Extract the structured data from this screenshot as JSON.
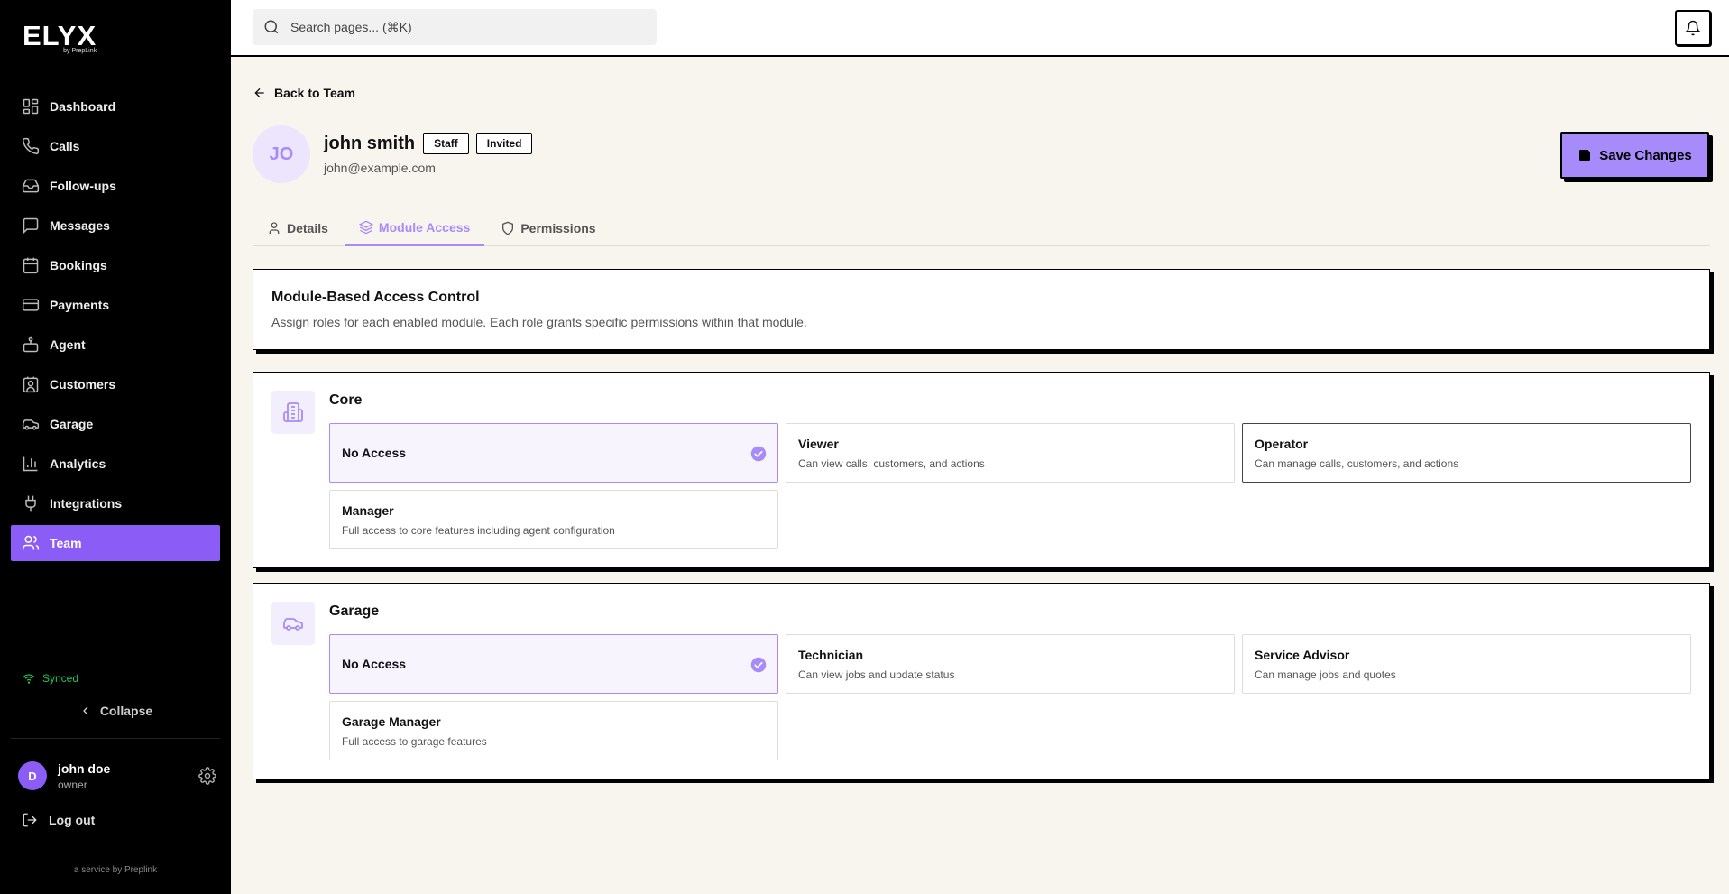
{
  "app": {
    "logo": "ELYX",
    "logo_sub": "by PrepLink"
  },
  "sidebar": {
    "items": [
      {
        "label": "Dashboard",
        "icon": "dashboard-icon"
      },
      {
        "label": "Calls",
        "icon": "phone-icon"
      },
      {
        "label": "Follow-ups",
        "icon": "inbox-icon"
      },
      {
        "label": "Messages",
        "icon": "message-icon"
      },
      {
        "label": "Bookings",
        "icon": "calendar-icon"
      },
      {
        "label": "Payments",
        "icon": "credit-card-icon"
      },
      {
        "label": "Agent",
        "icon": "bot-icon"
      },
      {
        "label": "Customers",
        "icon": "contact-icon"
      },
      {
        "label": "Garage",
        "icon": "car-icon"
      },
      {
        "label": "Analytics",
        "icon": "bar-chart-icon"
      },
      {
        "label": "Integrations",
        "icon": "plug-icon"
      },
      {
        "label": "Team",
        "icon": "users-icon",
        "active": true
      }
    ],
    "status": "Synced",
    "collapse_label": "Collapse",
    "user": {
      "initial": "D",
      "name": "john doe",
      "role": "owner"
    },
    "logout_label": "Log out",
    "footer": "a service by Preplink"
  },
  "topbar": {
    "search_placeholder": "Search pages... (⌘K)"
  },
  "page": {
    "back_label": "Back to Team",
    "avatar_initials": "JO",
    "user_name": "john smith",
    "badges": [
      "Staff",
      "Invited"
    ],
    "email": "john@example.com",
    "save_label": "Save Changes",
    "tabs": [
      {
        "label": "Details",
        "icon": "user-icon"
      },
      {
        "label": "Module Access",
        "icon": "layers-icon",
        "active": true
      },
      {
        "label": "Permissions",
        "icon": "shield-icon"
      }
    ],
    "info": {
      "title": "Module-Based Access Control",
      "desc": "Assign roles for each enabled module. Each role grants specific permissions within that module."
    },
    "modules": [
      {
        "title": "Core",
        "icon": "building-icon",
        "options": [
          {
            "title": "No Access",
            "desc": "",
            "selected": true
          },
          {
            "title": "Viewer",
            "desc": "Can view calls, customers, and actions"
          },
          {
            "title": "Operator",
            "desc": "Can manage calls, customers, and actions"
          },
          {
            "title": "Manager",
            "desc": "Full access to core features including agent configuration"
          }
        ]
      },
      {
        "title": "Garage",
        "icon": "car-icon",
        "options": [
          {
            "title": "No Access",
            "desc": "",
            "selected": true
          },
          {
            "title": "Technician",
            "desc": "Can view jobs and update status"
          },
          {
            "title": "Service Advisor",
            "desc": "Can manage jobs and quotes"
          },
          {
            "title": "Garage Manager",
            "desc": "Full access to garage features"
          }
        ]
      }
    ]
  },
  "colors": {
    "accent": "#8b5cf6",
    "accent_light": "#a78bfa",
    "synced": "#22c55e"
  }
}
